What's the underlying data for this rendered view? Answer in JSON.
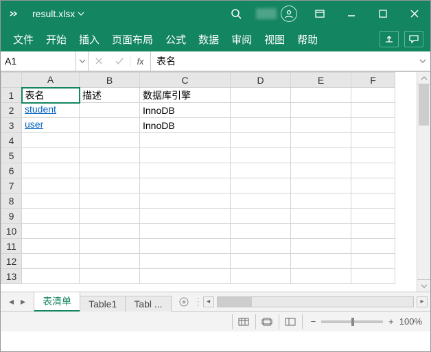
{
  "title": {
    "filename": "result.xlsx"
  },
  "ribbon": {
    "tabs": [
      "文件",
      "开始",
      "插入",
      "页面布局",
      "公式",
      "数据",
      "审阅",
      "视图",
      "帮助"
    ]
  },
  "namebox": {
    "value": "A1"
  },
  "formula": {
    "value": "表名",
    "fx_label": "fx"
  },
  "columns": [
    "A",
    "B",
    "C",
    "D",
    "E",
    "F"
  ],
  "rows_shown": 13,
  "cells": {
    "A1": {
      "text": "表名"
    },
    "B1": {
      "text": "描述"
    },
    "C1": {
      "text": "数据库引擎"
    },
    "A2": {
      "text": "student",
      "link": true
    },
    "C2": {
      "text": "InnoDB"
    },
    "A3": {
      "text": "user",
      "link": true
    },
    "C3": {
      "text": "InnoDB"
    }
  },
  "selected_cell": "A1",
  "sheet_tabs": {
    "items": [
      {
        "label": "表清单",
        "active": true,
        "truncated": false
      },
      {
        "label": "Table1",
        "active": false,
        "truncated": false
      },
      {
        "label": "Tabl ",
        "active": false,
        "truncated": true
      }
    ]
  },
  "status": {
    "zoom": "100%"
  }
}
